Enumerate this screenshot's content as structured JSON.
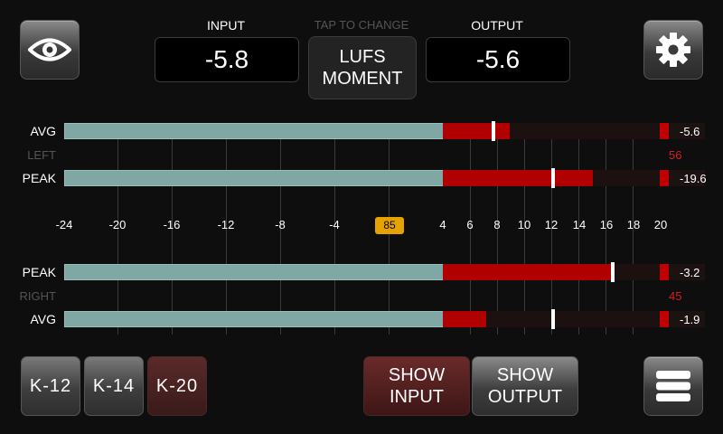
{
  "header": {
    "input_label": "INPUT",
    "input_value": "-5.8",
    "hint": "TAP TO CHANGE",
    "mode_line1": "LUFS",
    "mode_line2": "MOMENT",
    "output_label": "OUTPUT",
    "output_value": "-5.6"
  },
  "meters": {
    "left": {
      "channel": "LEFT",
      "channel_value": "56",
      "avg_label": "AVG",
      "avg_value": "-5.6",
      "peak_label": "PEAK",
      "peak_value": "-19.6"
    },
    "right": {
      "channel": "RIGHT",
      "channel_value": "45",
      "peak_label": "PEAK",
      "peak_value": "-3.2",
      "avg_label": "AVG",
      "avg_value": "-1.9"
    },
    "scale": [
      "-24",
      "-20",
      "-16",
      "-12",
      "-8",
      "-4",
      "4",
      "6",
      "8",
      "10",
      "12",
      "14",
      "16",
      "18",
      "20"
    ],
    "reference_badge": "85"
  },
  "footer": {
    "k12": "K-12",
    "k14": "K-14",
    "k20": "K-20",
    "show_input_1": "SHOW",
    "show_input_2": "INPUT",
    "show_output_1": "SHOW",
    "show_output_2": "OUTPUT"
  },
  "icons": {
    "eye": "eye-icon",
    "settings": "gear-icon",
    "menu": "menu-icon"
  },
  "colors": {
    "teal_bar": "#7fa7a3",
    "red_bar": "#b00000",
    "badge": "#e6a300"
  }
}
